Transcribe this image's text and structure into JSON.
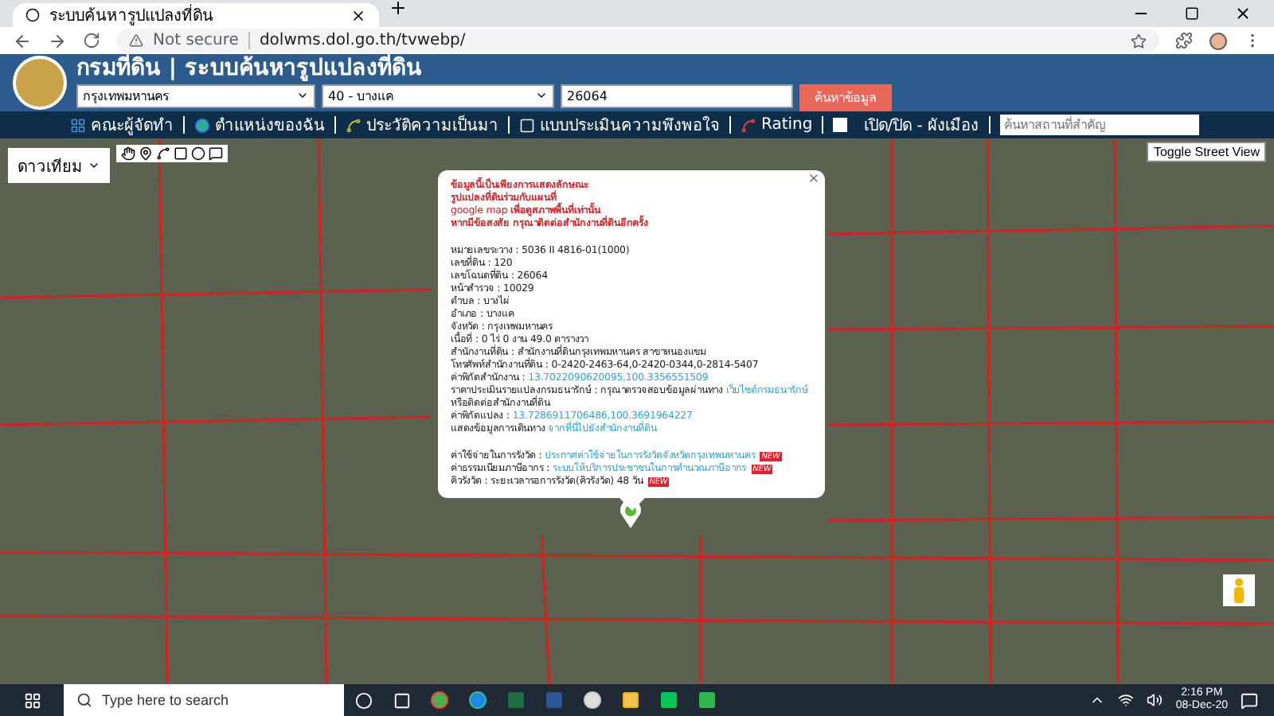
{
  "browser": {
    "tab_title": "ระบบค้นหารูปแปลงที่ดิน",
    "security": "Not secure",
    "url": "dolwms.dol.go.th/tvwebp/"
  },
  "header": {
    "title": "กรมที่ดิน | ระบบค้นหารูปแปลงที่ดิน",
    "province": "กรุงเทพมหานคร",
    "district": "40 - บางแค",
    "parcel_number": "26064",
    "search_button": "ค้นหาข้อมูล"
  },
  "nav": {
    "items": [
      {
        "label": "คณะผู้จัดทำ"
      },
      {
        "label": "ตำแหน่งของฉัน"
      },
      {
        "label": "ประวัติความเป็นมา"
      },
      {
        "label": "แบบประเมินความพึงพอใจ"
      },
      {
        "label": "Rating"
      }
    ],
    "toggle": {
      "label": "เปิด/ปิด - ผังเมือง",
      "checked": false
    },
    "place_search": {
      "placeholder": "ค้นหาสถานที่สำคัญ"
    }
  },
  "map": {
    "map_type": "ดาวเทียม",
    "street_view_button": "Toggle Street View"
  },
  "popup": {
    "disclaimer": [
      "ข้อมูลนี้เป็นเพียงการแสดงลักษณะ",
      "รูปแปลงที่ดินร่วมกับแผนที่",
      "google map **เพื่อดูสภาพพื้นที่เท่านั้น**",
      "หากมีข้อสงสัย กรุณาติดต่อสำนักงานที่ดินอีกครั้ง"
    ],
    "fields": [
      {
        "label": "หมายเลขระวาง :",
        "value": "5036 II 4816-01(1000)"
      },
      {
        "label": "เลขที่ดิน :",
        "value": "120"
      },
      {
        "label": "เลขโฉนดที่ดิน :",
        "value": "26064"
      },
      {
        "label": "หน้าสำรวจ :",
        "value": "10029"
      },
      {
        "label": "ตำบล :",
        "value": "บางไผ่"
      },
      {
        "label": "อำเภอ :",
        "value": "บางแค"
      },
      {
        "label": "จังหวัด :",
        "value": "กรุงเทพมหานคร"
      },
      {
        "label": "เนื้อที่ :",
        "value": "0 ไร่ 0 งาน 49.0 ตารางวา"
      },
      {
        "label": "สำนักงานที่ดิน :",
        "value": "สำนักงานที่ดินกรุงเทพมหานคร สาขาหนองแขม"
      },
      {
        "label": "โทรศัพท์สำนักงานที่ดิน :",
        "value": "0-2420-2463-64,0-2420-0344,0-2814-5407"
      },
      {
        "label": "ค่าพิกัดสำนักงาน :",
        "link": "13.7022090620095,100.3356551509"
      },
      {
        "label": "ราคาประเมินรายแปลงกรมธนารักษ์ :",
        "value": "กรุณาตรวจสอบข้อมูลผ่านทาง",
        "link": "เว็บไซต์กรมธนารักษ์",
        "after": "หรือติดต่อสำนักงานที่ดิน"
      },
      {
        "label": "ค่าพิกัดแปลง :",
        "link": "13.7286911706486,100.3691964227"
      },
      {
        "label": "แสดงข้อมูลการเดินทาง",
        "link": "จากที่นี่ไปยังสำนักงานที่ดิน"
      }
    ],
    "fees": [
      {
        "label": "ค่าใช้จ่ายในการรังวัด :",
        "link": "ประกาศค่าใช้จ่ายในการรังวัดจังหวัดกรุงเทพมหานคร",
        "badge": "NEW"
      },
      {
        "label": "ค่าธรรมเนียมภาษีอากร :",
        "link": "ระบบให้บริการประชาชนในการคำนวณภาษีอากร",
        "badge": "NEW"
      },
      {
        "label": "คิวรังวัด :",
        "value": "ระยะเวลารอการรังวัด(คิวรังวัด) 48 วัน",
        "badge": "NEW"
      }
    ]
  },
  "taskbar": {
    "search_placeholder": "Type here to search",
    "time": "2:16 PM",
    "date": "08-Dec-20"
  }
}
